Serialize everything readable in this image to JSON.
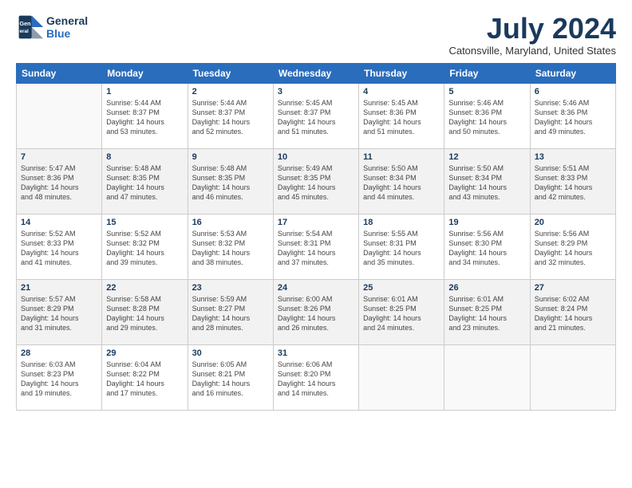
{
  "logo": {
    "line1": "General",
    "line2": "Blue"
  },
  "title": "July 2024",
  "location": "Catonsville, Maryland, United States",
  "weekdays": [
    "Sunday",
    "Monday",
    "Tuesday",
    "Wednesday",
    "Thursday",
    "Friday",
    "Saturday"
  ],
  "weeks": [
    [
      {
        "day": "",
        "sunrise": "",
        "sunset": "",
        "daylight": ""
      },
      {
        "day": "1",
        "sunrise": "Sunrise: 5:44 AM",
        "sunset": "Sunset: 8:37 PM",
        "daylight": "Daylight: 14 hours and 53 minutes."
      },
      {
        "day": "2",
        "sunrise": "Sunrise: 5:44 AM",
        "sunset": "Sunset: 8:37 PM",
        "daylight": "Daylight: 14 hours and 52 minutes."
      },
      {
        "day": "3",
        "sunrise": "Sunrise: 5:45 AM",
        "sunset": "Sunset: 8:37 PM",
        "daylight": "Daylight: 14 hours and 51 minutes."
      },
      {
        "day": "4",
        "sunrise": "Sunrise: 5:45 AM",
        "sunset": "Sunset: 8:36 PM",
        "daylight": "Daylight: 14 hours and 51 minutes."
      },
      {
        "day": "5",
        "sunrise": "Sunrise: 5:46 AM",
        "sunset": "Sunset: 8:36 PM",
        "daylight": "Daylight: 14 hours and 50 minutes."
      },
      {
        "day": "6",
        "sunrise": "Sunrise: 5:46 AM",
        "sunset": "Sunset: 8:36 PM",
        "daylight": "Daylight: 14 hours and 49 minutes."
      }
    ],
    [
      {
        "day": "7",
        "sunrise": "Sunrise: 5:47 AM",
        "sunset": "Sunset: 8:36 PM",
        "daylight": "Daylight: 14 hours and 48 minutes."
      },
      {
        "day": "8",
        "sunrise": "Sunrise: 5:48 AM",
        "sunset": "Sunset: 8:35 PM",
        "daylight": "Daylight: 14 hours and 47 minutes."
      },
      {
        "day": "9",
        "sunrise": "Sunrise: 5:48 AM",
        "sunset": "Sunset: 8:35 PM",
        "daylight": "Daylight: 14 hours and 46 minutes."
      },
      {
        "day": "10",
        "sunrise": "Sunrise: 5:49 AM",
        "sunset": "Sunset: 8:35 PM",
        "daylight": "Daylight: 14 hours and 45 minutes."
      },
      {
        "day": "11",
        "sunrise": "Sunrise: 5:50 AM",
        "sunset": "Sunset: 8:34 PM",
        "daylight": "Daylight: 14 hours and 44 minutes."
      },
      {
        "day": "12",
        "sunrise": "Sunrise: 5:50 AM",
        "sunset": "Sunset: 8:34 PM",
        "daylight": "Daylight: 14 hours and 43 minutes."
      },
      {
        "day": "13",
        "sunrise": "Sunrise: 5:51 AM",
        "sunset": "Sunset: 8:33 PM",
        "daylight": "Daylight: 14 hours and 42 minutes."
      }
    ],
    [
      {
        "day": "14",
        "sunrise": "Sunrise: 5:52 AM",
        "sunset": "Sunset: 8:33 PM",
        "daylight": "Daylight: 14 hours and 41 minutes."
      },
      {
        "day": "15",
        "sunrise": "Sunrise: 5:52 AM",
        "sunset": "Sunset: 8:32 PM",
        "daylight": "Daylight: 14 hours and 39 minutes."
      },
      {
        "day": "16",
        "sunrise": "Sunrise: 5:53 AM",
        "sunset": "Sunset: 8:32 PM",
        "daylight": "Daylight: 14 hours and 38 minutes."
      },
      {
        "day": "17",
        "sunrise": "Sunrise: 5:54 AM",
        "sunset": "Sunset: 8:31 PM",
        "daylight": "Daylight: 14 hours and 37 minutes."
      },
      {
        "day": "18",
        "sunrise": "Sunrise: 5:55 AM",
        "sunset": "Sunset: 8:31 PM",
        "daylight": "Daylight: 14 hours and 35 minutes."
      },
      {
        "day": "19",
        "sunrise": "Sunrise: 5:56 AM",
        "sunset": "Sunset: 8:30 PM",
        "daylight": "Daylight: 14 hours and 34 minutes."
      },
      {
        "day": "20",
        "sunrise": "Sunrise: 5:56 AM",
        "sunset": "Sunset: 8:29 PM",
        "daylight": "Daylight: 14 hours and 32 minutes."
      }
    ],
    [
      {
        "day": "21",
        "sunrise": "Sunrise: 5:57 AM",
        "sunset": "Sunset: 8:29 PM",
        "daylight": "Daylight: 14 hours and 31 minutes."
      },
      {
        "day": "22",
        "sunrise": "Sunrise: 5:58 AM",
        "sunset": "Sunset: 8:28 PM",
        "daylight": "Daylight: 14 hours and 29 minutes."
      },
      {
        "day": "23",
        "sunrise": "Sunrise: 5:59 AM",
        "sunset": "Sunset: 8:27 PM",
        "daylight": "Daylight: 14 hours and 28 minutes."
      },
      {
        "day": "24",
        "sunrise": "Sunrise: 6:00 AM",
        "sunset": "Sunset: 8:26 PM",
        "daylight": "Daylight: 14 hours and 26 minutes."
      },
      {
        "day": "25",
        "sunrise": "Sunrise: 6:01 AM",
        "sunset": "Sunset: 8:25 PM",
        "daylight": "Daylight: 14 hours and 24 minutes."
      },
      {
        "day": "26",
        "sunrise": "Sunrise: 6:01 AM",
        "sunset": "Sunset: 8:25 PM",
        "daylight": "Daylight: 14 hours and 23 minutes."
      },
      {
        "day": "27",
        "sunrise": "Sunrise: 6:02 AM",
        "sunset": "Sunset: 8:24 PM",
        "daylight": "Daylight: 14 hours and 21 minutes."
      }
    ],
    [
      {
        "day": "28",
        "sunrise": "Sunrise: 6:03 AM",
        "sunset": "Sunset: 8:23 PM",
        "daylight": "Daylight: 14 hours and 19 minutes."
      },
      {
        "day": "29",
        "sunrise": "Sunrise: 6:04 AM",
        "sunset": "Sunset: 8:22 PM",
        "daylight": "Daylight: 14 hours and 17 minutes."
      },
      {
        "day": "30",
        "sunrise": "Sunrise: 6:05 AM",
        "sunset": "Sunset: 8:21 PM",
        "daylight": "Daylight: 14 hours and 16 minutes."
      },
      {
        "day": "31",
        "sunrise": "Sunrise: 6:06 AM",
        "sunset": "Sunset: 8:20 PM",
        "daylight": "Daylight: 14 hours and 14 minutes."
      },
      {
        "day": "",
        "sunrise": "",
        "sunset": "",
        "daylight": ""
      },
      {
        "day": "",
        "sunrise": "",
        "sunset": "",
        "daylight": ""
      },
      {
        "day": "",
        "sunrise": "",
        "sunset": "",
        "daylight": ""
      }
    ]
  ]
}
